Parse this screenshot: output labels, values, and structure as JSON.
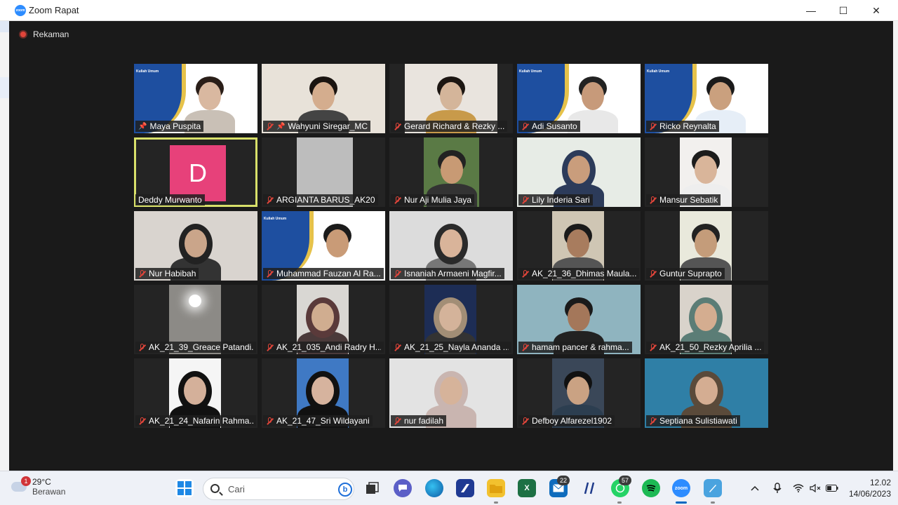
{
  "window": {
    "title": "Zoom Rapat",
    "logo_text": "zoom",
    "minimize": "—",
    "maximize": "☐",
    "close": "✕"
  },
  "recording": {
    "label": "Rekaman"
  },
  "slide": {
    "heading": "Kuliah Umum"
  },
  "participants": [
    {
      "name": "Maya Puspita",
      "pinned": true,
      "muted": false
    },
    {
      "name": "Wahyuni Siregar_MC",
      "pinned": true,
      "muted": true
    },
    {
      "name": "Gerard Richard & Rezky ...",
      "muted": true
    },
    {
      "name": "Adi Susanto",
      "muted": true
    },
    {
      "name": "Ricko Reynalta",
      "muted": true
    },
    {
      "name": "Deddy Murwanto",
      "avatar_letter": "D",
      "active_speaker": true
    },
    {
      "name": "ARGIANTA BARUS_AK20",
      "muted": true
    },
    {
      "name": "Nur Aji Mulia Jaya",
      "muted": true
    },
    {
      "name": "Lily Inderia Sari",
      "muted": true
    },
    {
      "name": "Mansur Sebatik",
      "muted": true
    },
    {
      "name": "Nur Habibah",
      "muted": true
    },
    {
      "name": "Muhammad Fauzan Al Ra...",
      "muted": true
    },
    {
      "name": "Isnaniah Armaeni Magfir...",
      "muted": true
    },
    {
      "name": "AK_21_36_Dhimas Maula...",
      "muted": true
    },
    {
      "name": "Guntur Suprapto",
      "muted": true
    },
    {
      "name": "AK_21_39_Greace Patandi...",
      "muted": true
    },
    {
      "name": "AK_21_035_Andi Radry H...",
      "muted": true
    },
    {
      "name": "AK_21_25_Nayla Ananda ...",
      "muted": true
    },
    {
      "name": "hamam pancer & rahma...",
      "muted": true
    },
    {
      "name": "AK_21_50_Rezky Aprilia ...",
      "muted": true
    },
    {
      "name": "AK_21_24_Nafarin Rahma...",
      "muted": true
    },
    {
      "name": "AK_21_47_Sri Wildayani",
      "muted": true
    },
    {
      "name": "nur fadilah",
      "muted": true
    },
    {
      "name": "Defboy Alfarezel1902",
      "muted": true
    },
    {
      "name": "Septiana Sulistiawati",
      "muted": true
    }
  ],
  "taskbar": {
    "weather": {
      "temp": "29°C",
      "condition": "Berawan",
      "badge": "1"
    },
    "search_placeholder": "Cari",
    "bing_glyph": "b",
    "mail_badge": "22",
    "whatsapp_badge": "57",
    "zoom_label": "zoom",
    "excel_glyph": "X",
    "clock": {
      "time": "12.02",
      "date": "14/06/2023"
    }
  }
}
